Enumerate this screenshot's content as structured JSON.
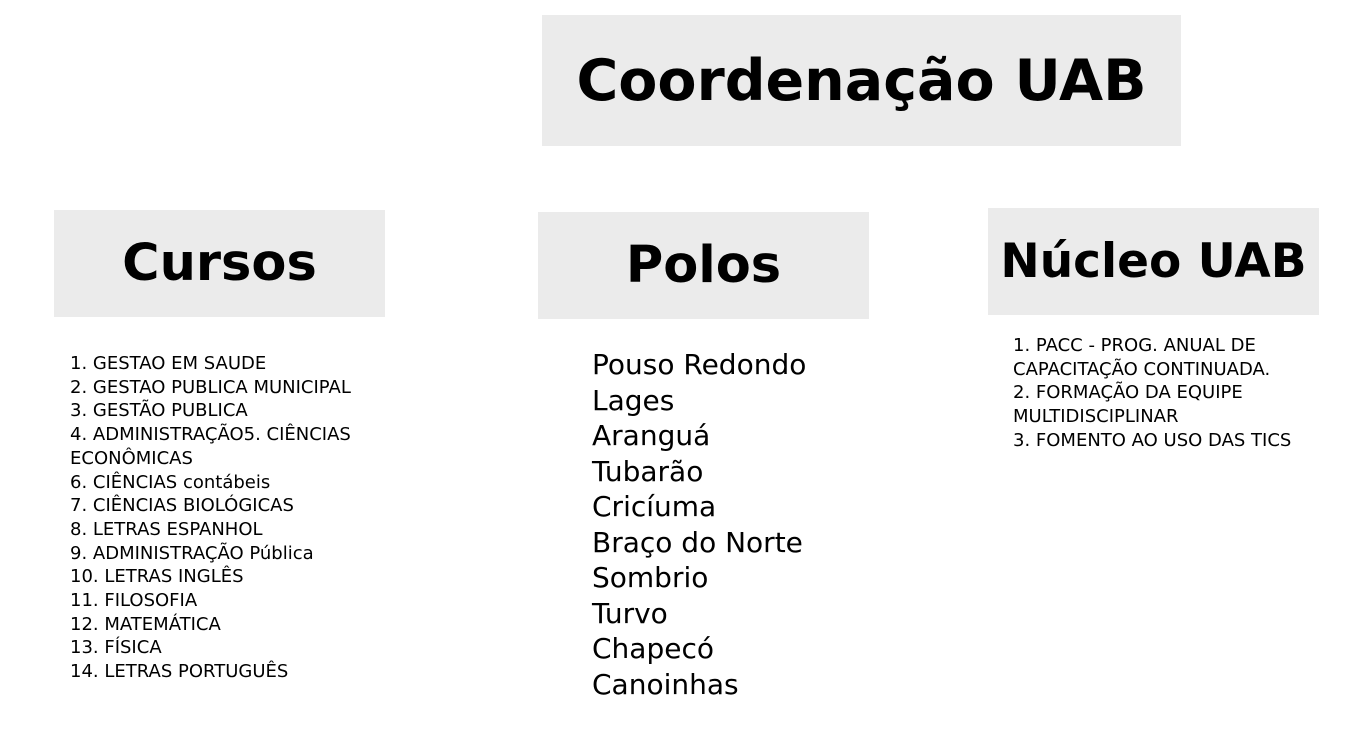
{
  "diagram": {
    "title": "Coordenação UAB",
    "columns": [
      {
        "heading": "Cursos",
        "items": [
          "1. GESTAO EM SAUDE",
          "2. GESTAO PUBLICA MUNICIPAL",
          "3. GESTÃO PUBLICA",
          "4. ADMINISTRAÇÃO5. CIÊNCIAS ECONÔMICAS",
          "6. CIÊNCIAS contábeis",
          "7. CIÊNCIAS BIOLÓGICAS",
          "8. LETRAS ESPANHOL",
          "9. ADMINISTRAÇÃO Pública",
          "10. LETRAS INGLÊS",
          "11. FILOSOFIA",
          "12. MATEMÁTICA",
          "13. FÍSICA",
          "14. LETRAS PORTUGUÊS"
        ]
      },
      {
        "heading": "Polos",
        "items": [
          "Pouso Redondo",
          "Lages",
          "Aranguá",
          "Tubarão",
          "Cricíuma",
          "Braço do Norte",
          "Sombrio",
          "Turvo",
          "Chapecó",
          "Canoinhas"
        ]
      },
      {
        "heading": "Núcleo UAB",
        "items": [
          "1. PACC - PROG. ANUAL DE CAPACITAÇÃO CONTINUADA.",
          "2. FORMAÇÃO DA EQUIPE MULTIDISCIPLINAR",
          "3. FOMENTO AO USO DAS TICS"
        ]
      }
    ],
    "colors": {
      "box_fill": "#ebebeb",
      "text": "#000000",
      "background": "#ffffff"
    }
  }
}
